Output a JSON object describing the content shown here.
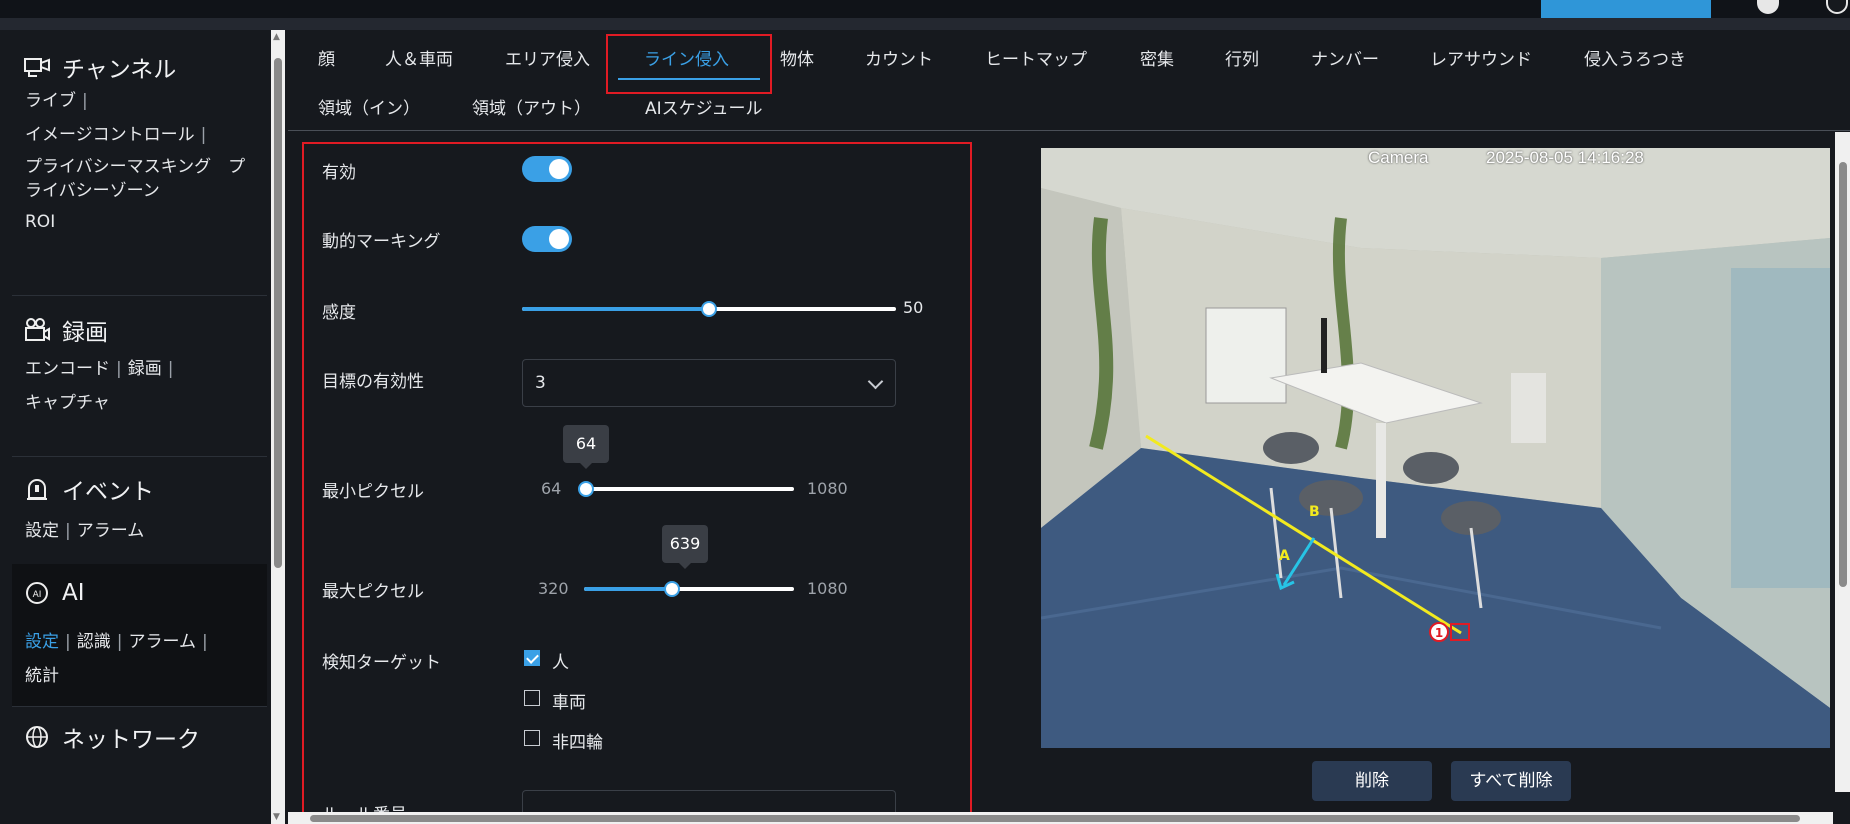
{
  "sidebar": {
    "channel": {
      "title": "チャンネル",
      "items": [
        "ライブ",
        "イメージコントロール",
        "プライバシーマスキング",
        "プライバシーゾーン",
        "ROI"
      ]
    },
    "record": {
      "title": "録画",
      "items": [
        "エンコード",
        "録画",
        "キャプチャ"
      ]
    },
    "event": {
      "title": "イベント",
      "items": [
        "設定",
        "アラーム"
      ]
    },
    "ai": {
      "title": "AI",
      "items": [
        "設定",
        "認識",
        "アラーム",
        "統計"
      ]
    },
    "network": {
      "title": "ネットワーク"
    }
  },
  "tabs": {
    "row1": [
      "顔",
      "人＆車両",
      "エリア侵入",
      "ライン侵入",
      "物体",
      "カウント",
      "ヒートマップ",
      "密集",
      "行列",
      "ナンバー",
      "レアサウンド",
      "侵入うろつき"
    ],
    "row2": [
      "領域（イン）",
      "領域（アウト）",
      "AIスケジュール"
    ],
    "active": "ライン侵入"
  },
  "form": {
    "enable_label": "有効",
    "enable_on": true,
    "dynamic_marking_label": "動的マーキング",
    "dynamic_marking_on": true,
    "sensitivity_label": "感度",
    "sensitivity_value": "50",
    "sensitivity_level": 50,
    "target_validity_label": "目標の有効性",
    "target_validity_value": "3",
    "min_pixel_label": "最小ピクセル",
    "min_pixel_min": "64",
    "min_pixel_max": "1080",
    "min_pixel_value": "64",
    "max_pixel_label": "最大ピクセル",
    "max_pixel_min": "320",
    "max_pixel_max": "1080",
    "max_pixel_value": "639",
    "detect_target_label": "検知ターゲット",
    "targets": [
      {
        "label": "人",
        "checked": true
      },
      {
        "label": "車両",
        "checked": false
      },
      {
        "label": "非四輪",
        "checked": false
      }
    ],
    "rule_number_label": "ルール番号"
  },
  "video": {
    "camera_name": "Camera",
    "timestamp": "2025-08-05 14:16:28",
    "line_label_a": "A",
    "line_label_b": "B",
    "rule_index": "1"
  },
  "buttons": {
    "delete": "削除",
    "delete_all": "すべて削除"
  },
  "colors": {
    "accent": "#3aa0e6",
    "highlight_box": "#e01b24",
    "line": "#f2ea1f",
    "direction_arrow": "#27c4e6"
  }
}
